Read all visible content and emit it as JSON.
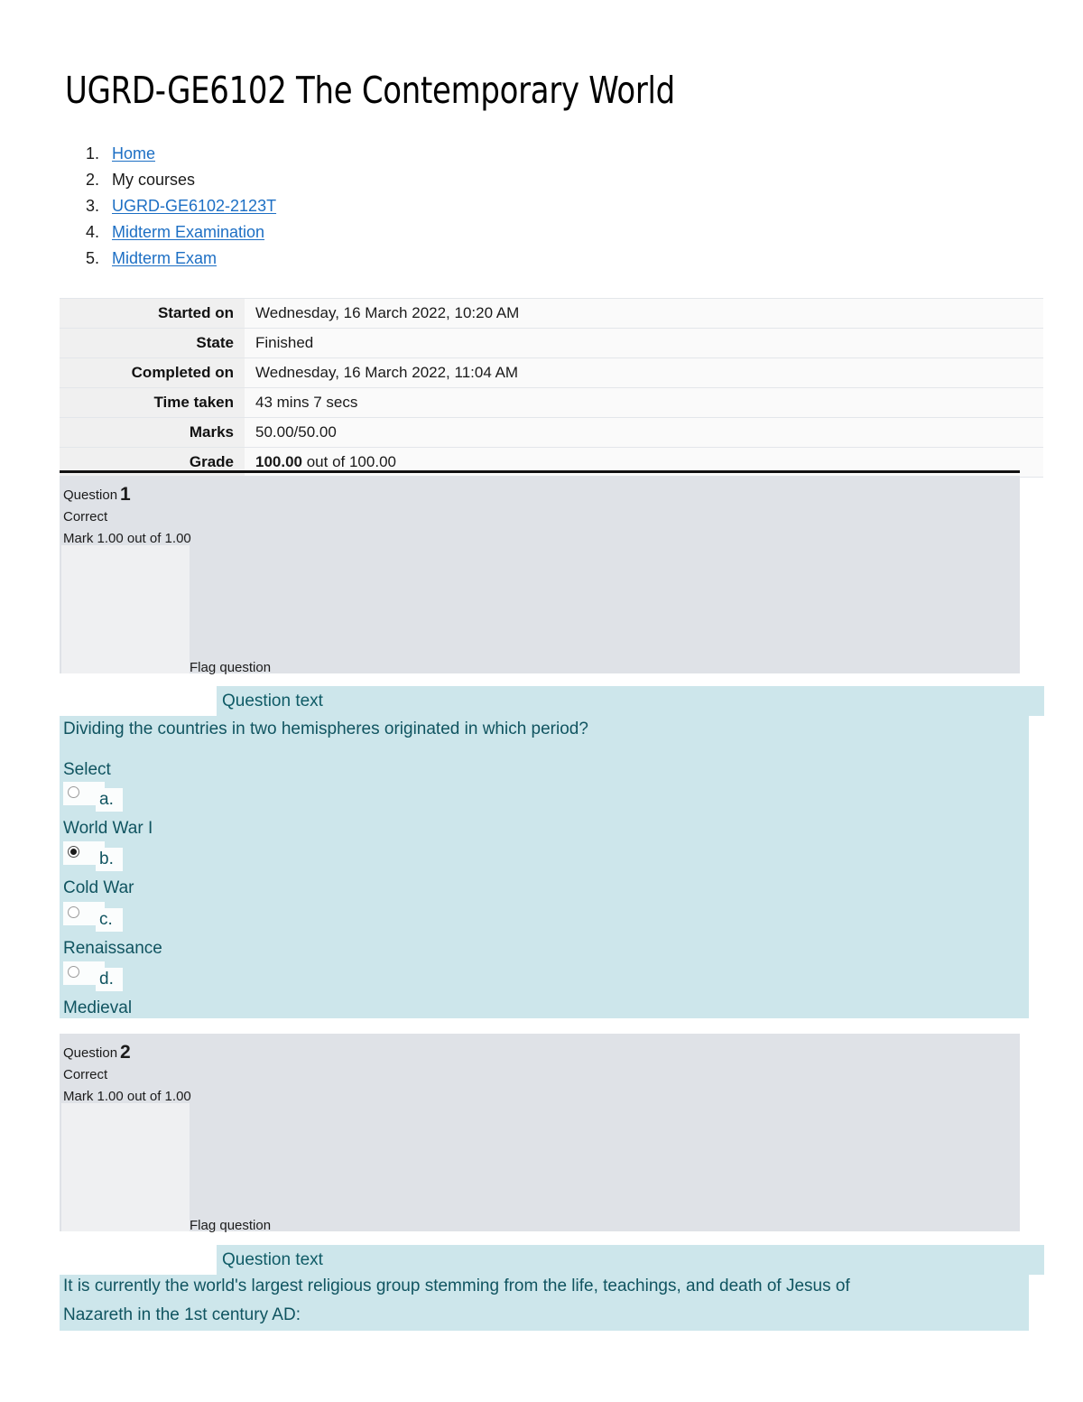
{
  "page": {
    "title": "UGRD-GE6102 The Contemporary World"
  },
  "breadcrumb": {
    "items": [
      {
        "num": "1.",
        "label": "Home",
        "is_link": true
      },
      {
        "num": "2.",
        "label": "My courses",
        "is_link": false
      },
      {
        "num": "3.",
        "label": "UGRD-GE6102-2123T",
        "is_link": true
      },
      {
        "num": "4.",
        "label": "Midterm Examination",
        "is_link": true
      },
      {
        "num": "5.",
        "label": "Midterm Exam",
        "is_link": true
      }
    ]
  },
  "summary": {
    "rows": [
      {
        "label": "Started on",
        "value": "Wednesday, 16 March 2022, 10:20 AM"
      },
      {
        "label": "State",
        "value": "Finished"
      },
      {
        "label": "Completed on",
        "value": "Wednesday, 16 March 2022, 11:04 AM"
      },
      {
        "label": "Time taken",
        "value": "43 mins 7 secs"
      },
      {
        "label": "Marks",
        "value": "50.00/50.00"
      },
      {
        "label": "Grade",
        "value_bold": "100.00",
        "value_rest": " out of 100.00"
      }
    ]
  },
  "questions": [
    {
      "label": "Question",
      "number": "1",
      "state": "Correct",
      "mark": "Mark 1.00 out of 1.00",
      "flag": "Flag question",
      "question_text_label": "Question text",
      "stem": "Dividing the countries in two hemispheres originated in which period?",
      "select_one": "Select one:",
      "options": [
        {
          "letter": "a.",
          "text": "World War I",
          "checked": false
        },
        {
          "letter": "b.",
          "text": "Cold War",
          "checked": true
        },
        {
          "letter": "c.",
          "text": "Renaissance",
          "checked": false
        },
        {
          "letter": "d.",
          "text": "Medieval",
          "checked": false
        }
      ]
    },
    {
      "label": "Question",
      "number": "2",
      "state": "Correct",
      "mark": "Mark 1.00 out of 1.00",
      "flag": "Flag question",
      "question_text_label": "Question text",
      "stem_line1": "It is currently the world's largest religious group stemming from the life, teachings, and death of Jesus of",
      "stem_line2": "Nazareth in the 1st century AD:"
    }
  ],
  "colors": {
    "link": "#1d6fc4",
    "question_header_bg": "#dfe2e7",
    "question_body_bg": "#cde6eb",
    "question_body_text": "#105460",
    "inner_box_bg": "#eff0f2"
  }
}
